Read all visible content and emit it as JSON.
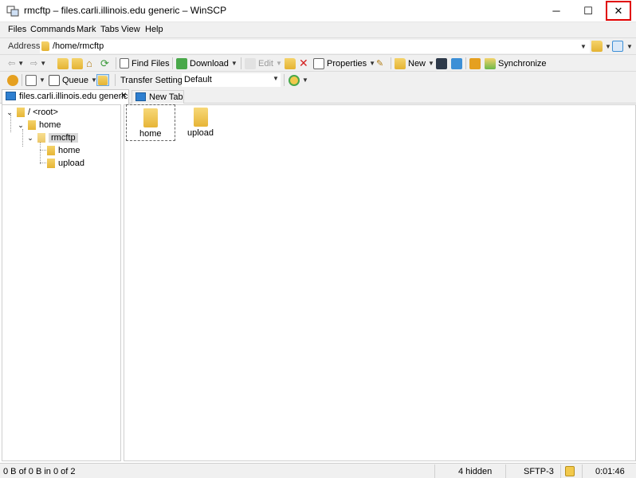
{
  "window": {
    "title": "rmcftp – files.carli.illinois.edu generic – WinSCP",
    "minimize_glyph": "─",
    "maximize_glyph": "☐",
    "close_glyph": "✕"
  },
  "menu": [
    "Files",
    "Commands",
    "Mark",
    "Tabs",
    "View",
    "Help"
  ],
  "address": {
    "label": "Address",
    "path": "/home/rmcftp"
  },
  "toolbar1": {
    "find_files": "Find Files",
    "download": "Download",
    "edit": "Edit",
    "properties": "Properties",
    "new": "New",
    "synchronize": "Synchronize"
  },
  "toolbar2": {
    "queue": "Queue",
    "transfer_settings_label": "Transfer Settings",
    "transfer_settings_value": "Default"
  },
  "tabs": {
    "active": "files.carli.illinois.edu generic",
    "new": "New Tab",
    "close_glyph": "✕"
  },
  "tree": {
    "root": "/ <root>",
    "home": "home",
    "rmcftp": "rmcftp",
    "child_home": "home",
    "child_upload": "upload"
  },
  "files": [
    "home",
    "upload"
  ],
  "status": {
    "selection": "0 B of 0 B in 0 of 2",
    "hidden": "4 hidden",
    "protocol": "SFTP-3",
    "elapsed": "0:01:46"
  },
  "colors": {
    "close_highlight": "#e00000",
    "folder": "#e6b536",
    "chrome": "#f0f0f0"
  }
}
